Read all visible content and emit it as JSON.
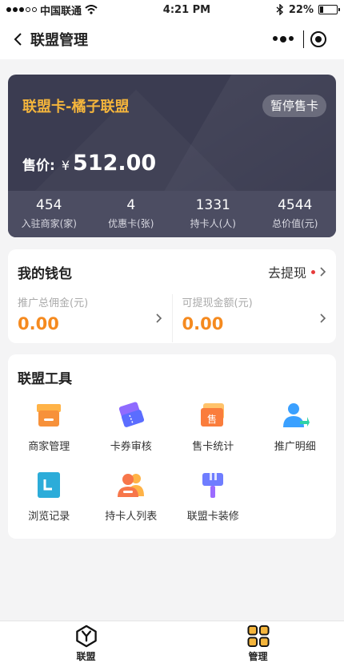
{
  "status_bar": {
    "carrier": "中国联通",
    "time": "4:21 PM",
    "battery": "22%",
    "battery_level": 0.22
  },
  "nav": {
    "title": "联盟管理"
  },
  "hero": {
    "title": "联盟卡-橘子联盟",
    "badge": "暂停售卡",
    "price_label": "售价:",
    "currency": "¥",
    "price": "512.00",
    "stats": [
      {
        "value": "454",
        "label": "入驻商家(家)"
      },
      {
        "value": "4",
        "label": "优惠卡(张)"
      },
      {
        "value": "1331",
        "label": "持卡人(人)"
      },
      {
        "value": "4544",
        "label": "总价值(元)"
      }
    ]
  },
  "wallet": {
    "title": "我的钱包",
    "withdraw_label": "去提现",
    "columns": [
      {
        "label": "推广总佣金(元)",
        "value": "0.00"
      },
      {
        "label": "可提现金额(元)",
        "value": "0.00"
      }
    ]
  },
  "tools": {
    "title": "联盟工具",
    "items": [
      {
        "label": "商家管理",
        "icon": "store-icon"
      },
      {
        "label": "卡券审核",
        "icon": "coupon-icon"
      },
      {
        "label": "售卡统计",
        "icon": "card-sales-icon"
      },
      {
        "label": "推广明细",
        "icon": "user-promo-icon"
      },
      {
        "label": "浏览记录",
        "icon": "browse-icon"
      },
      {
        "label": "持卡人列表",
        "icon": "cardholders-icon"
      },
      {
        "label": "联盟卡装修",
        "icon": "brush-icon"
      }
    ]
  },
  "tabbar": {
    "items": [
      {
        "label": "联盟",
        "icon": "hexagon-y-icon"
      },
      {
        "label": "管理",
        "icon": "grid-icon"
      }
    ]
  },
  "colors": {
    "accent_orange": "#f58a1f",
    "hero_gold": "#f4b53c",
    "hero_bg": "#3b3c51"
  }
}
